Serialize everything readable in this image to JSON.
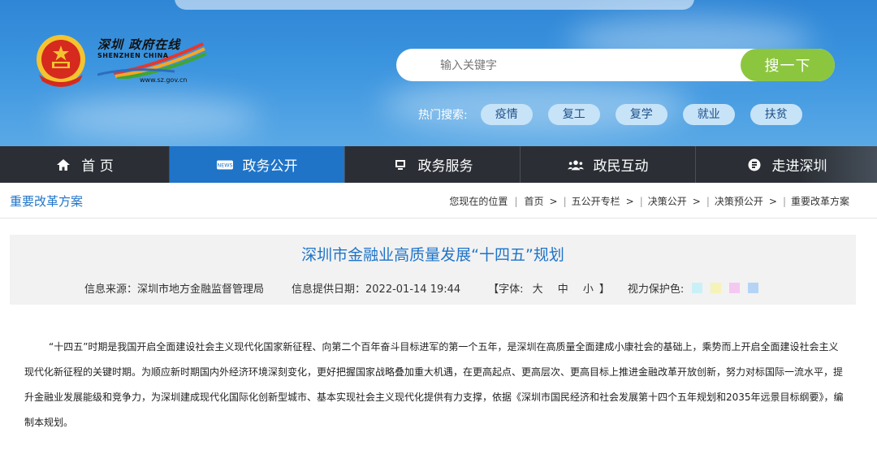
{
  "header": {
    "logo": {
      "title": "深圳 政府在线",
      "subtitle": "SHENZHEN CHINA",
      "url": "www.sz.gov.cn"
    },
    "search": {
      "placeholder": "输入关键字",
      "button_label": "搜一下"
    },
    "hot_search": {
      "label": "热门搜索:",
      "tags": [
        "疫情",
        "复工",
        "复学",
        "就业",
        "扶贫"
      ]
    }
  },
  "nav": {
    "items": [
      {
        "label": "首 页",
        "icon": "home-icon"
      },
      {
        "label": "政务公开",
        "icon": "news-icon",
        "active": true
      },
      {
        "label": "政务服务",
        "icon": "monitor-icon"
      },
      {
        "label": "政民互动",
        "icon": "people-icon"
      },
      {
        "label": "走进深圳",
        "icon": "coin-icon"
      }
    ]
  },
  "breadcrumb": {
    "section_title": "重要改革方案",
    "location_label": "您现在的位置",
    "items": [
      "首页",
      "五公开专栏",
      "决策公开",
      "决策预公开",
      "重要改革方案"
    ]
  },
  "article": {
    "title": "深圳市金融业高质量发展“十四五”规划",
    "source": "信息来源：深圳市地方金融监督管理局",
    "date": "信息提供日期：2022-01-14 19:44",
    "font_label_open": "【字体:",
    "font_sizes": [
      "大",
      "中",
      "小"
    ],
    "font_label_close": "】",
    "eye_label": "视力保护色:",
    "eye_colors": [
      "#c9f0f7",
      "#f5f3b8",
      "#f5c8f0",
      "#b5d4f5"
    ],
    "body": "“十四五”时期是我国开启全面建设社会主义现代化国家新征程、向第二个百年奋斗目标进军的第一个五年，是深圳在高质量全面建成小康社会的基础上，乘势而上开启全面建设社会主义现代化新征程的关键时期。为顺应新时期国内外经济环境深刻变化，更好把握国家战略叠加重大机遇，在更高起点、更高层次、更高目标上推进金融改革开放创新，努力对标国际一流水平，提升金融业发展能级和竞争力，为深圳建成现代化国际化创新型城市、基本实现社会主义现代化提供有力支撑，依据《深圳市国民经济和社会发展第十四个五年规划和2035年远景目标纲要》，编制本规划。"
  },
  "colors": {
    "brand_blue": "#1f74c8",
    "nav_dark": "#2b2f35",
    "search_green": "#8cc63f"
  }
}
